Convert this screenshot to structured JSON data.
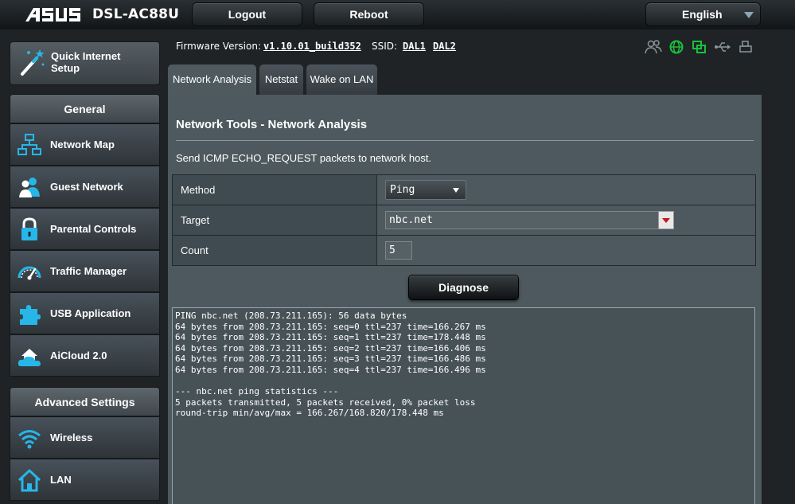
{
  "header": {
    "brand": "ASUS",
    "model": "DSL-AC88U",
    "logout_label": "Logout",
    "reboot_label": "Reboot",
    "language": "English"
  },
  "sidebar": {
    "quick_setup_line1": "Quick Internet",
    "quick_setup_line2": "Setup",
    "general_heading": "General",
    "general_items": [
      {
        "label": "Network Map",
        "icon": "network-map-icon"
      },
      {
        "label": "Guest Network",
        "icon": "guest-network-icon"
      },
      {
        "label": "Parental Controls",
        "icon": "lock-icon"
      },
      {
        "label": "Traffic Manager",
        "icon": "speedometer-icon"
      },
      {
        "label": "USB Application",
        "icon": "puzzle-icon"
      },
      {
        "label": "AiCloud 2.0",
        "icon": "cloud-house-icon"
      }
    ],
    "advanced_heading": "Advanced Settings",
    "advanced_items": [
      {
        "label": "Wireless",
        "icon": "wifi-icon"
      },
      {
        "label": "LAN",
        "icon": "house-icon"
      }
    ]
  },
  "info": {
    "firmware_label": "Firmware Version:",
    "firmware_value": "v1.10.01_build352",
    "ssid_label": "SSID:",
    "ssid_1": "DAL1",
    "ssid_2": "DAL2"
  },
  "tabs": [
    {
      "label": "Network Analysis",
      "active": true
    },
    {
      "label": "Netstat",
      "active": false
    },
    {
      "label": "Wake on LAN",
      "active": false
    }
  ],
  "main": {
    "title": "Network Tools - Network Analysis",
    "description": "Send ICMP ECHO_REQUEST packets to network host.",
    "method_label": "Method",
    "method_value": "Ping",
    "target_label": "Target",
    "target_value": "nbc.net",
    "count_label": "Count",
    "count_value": "5",
    "diagnose_label": "Diagnose",
    "output": "PING nbc.net (208.73.211.165): 56 data bytes\n64 bytes from 208.73.211.165: seq=0 ttl=237 time=166.267 ms\n64 bytes from 208.73.211.165: seq=1 ttl=237 time=178.448 ms\n64 bytes from 208.73.211.165: seq=2 ttl=237 time=166.406 ms\n64 bytes from 208.73.211.165: seq=3 ttl=237 time=166.486 ms\n64 bytes from 208.73.211.165: seq=4 ttl=237 time=166.496 ms\n\n--- nbc.net ping statistics ---\n5 packets transmitted, 5 packets received, 0% packet loss\nround-trip min/avg/max = 166.267/168.820/178.448 ms"
  },
  "colors": {
    "accent_green": "#19c23a",
    "caret_red": "#c8121c",
    "panel_bg": "#4d595e"
  }
}
